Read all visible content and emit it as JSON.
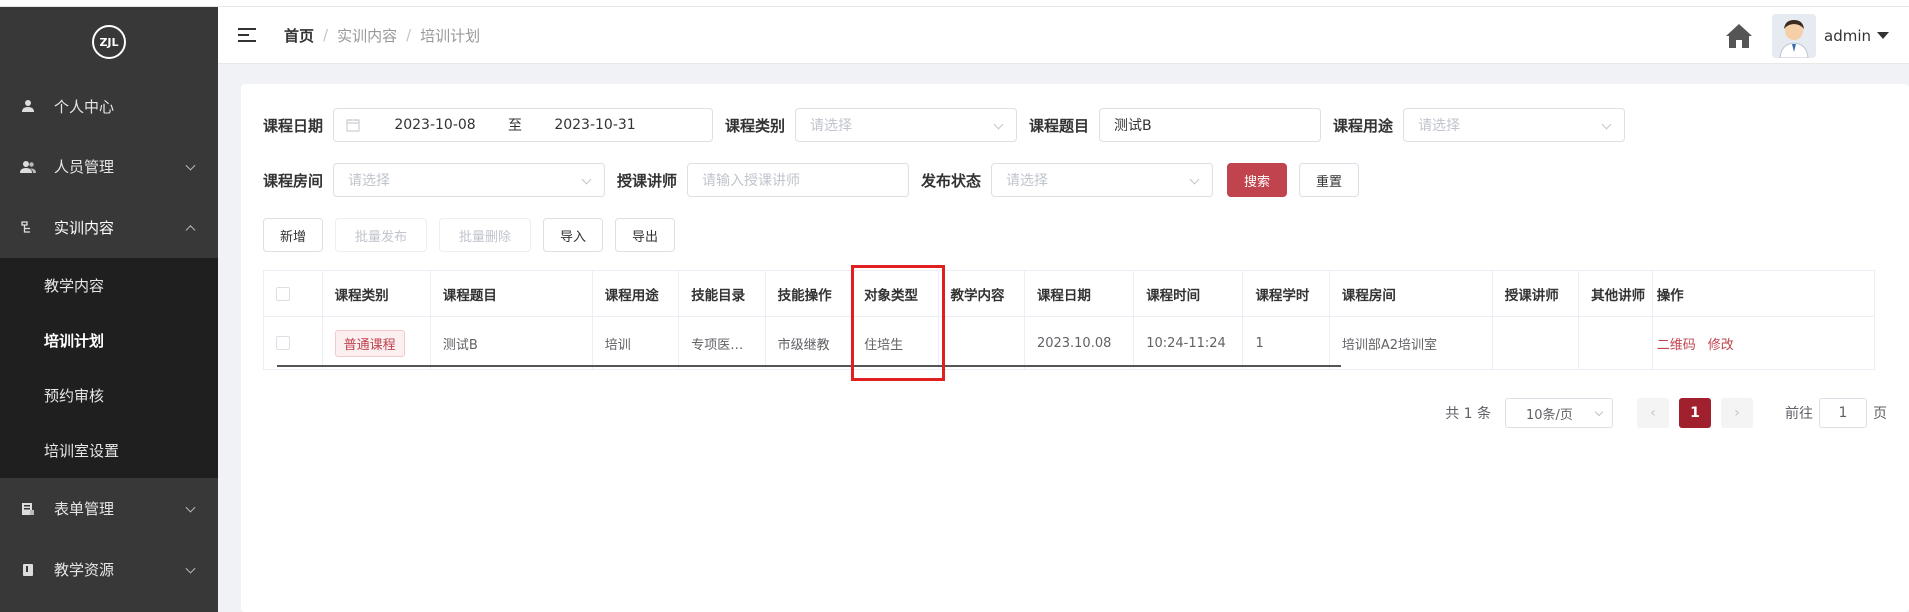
{
  "sidebar": {
    "logo_text": "ZJL",
    "items": [
      {
        "label": "个人中心",
        "icon": "user-icon"
      },
      {
        "label": "人员管理",
        "icon": "users-icon"
      },
      {
        "label": "实训内容",
        "icon": "tree-icon"
      },
      {
        "label": "表单管理",
        "icon": "form-icon"
      },
      {
        "label": "教学资源",
        "icon": "book-icon"
      }
    ],
    "submenu": [
      "教学内容",
      "培训计划",
      "预约审核",
      "培训室设置"
    ],
    "active_sub": "培训计划"
  },
  "header": {
    "breadcrumb": [
      "首页",
      "实训内容",
      "培训计划"
    ],
    "username": "admin"
  },
  "filters": {
    "date_label": "课程日期",
    "date_start": "2023-10-08",
    "date_sep": "至",
    "date_end": "2023-10-31",
    "category_label": "课程类别",
    "category_placeholder": "请选择",
    "title_label": "课程题目",
    "title_value": "测试B",
    "usage_label": "课程用途",
    "usage_placeholder": "请选择",
    "room_label": "课程房间",
    "room_placeholder": "请选择",
    "teacher_label": "授课讲师",
    "teacher_placeholder": "请输入授课讲师",
    "status_label": "发布状态",
    "status_placeholder": "请选择",
    "search_label": "搜索",
    "reset_label": "重置"
  },
  "toolbar": {
    "add": "新增",
    "batch_publish": "批量发布",
    "batch_delete": "批量删除",
    "import": "导入",
    "export": "导出"
  },
  "table": {
    "columns": [
      "课程类别",
      "课程题目",
      "课程用途",
      "技能目录",
      "技能操作",
      "对象类型",
      "教学内容",
      "课程日期",
      "课程时间",
      "课程学时",
      "课程房间",
      "授课讲师",
      "其他讲师",
      "操作"
    ],
    "rows": [
      {
        "category": "普通课程",
        "title": "测试B",
        "usage": "培训",
        "skill_dir": "专项医…",
        "skill_op": "市级继教",
        "target": "住培生",
        "content": "",
        "date": "2023.10.08",
        "time": "10:24-11:24",
        "hours": "1",
        "room": "培训部A2培训室",
        "teacher": "",
        "other": "",
        "ops": [
          "二维码",
          "修改"
        ]
      }
    ]
  },
  "pagination": {
    "total_text": "共 1 条",
    "page_size": "10条/页",
    "current_page": "1",
    "goto_label": "前往",
    "goto_value": "1",
    "page_suffix": "页"
  },
  "colors": {
    "sidebar_bg": "#383838",
    "submenu_bg": "#1f1f1f",
    "accent": "#c0434e",
    "highlight_box": "#e02020"
  }
}
